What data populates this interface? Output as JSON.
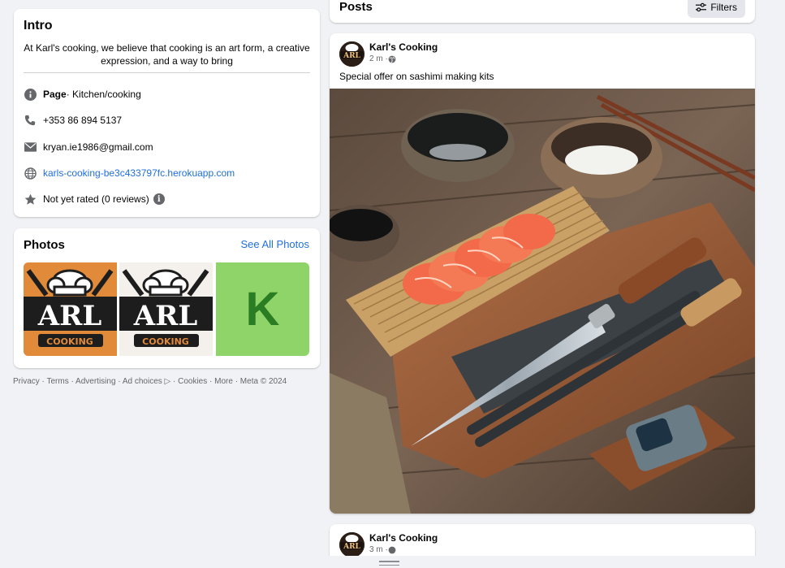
{
  "intro": {
    "title": "Intro",
    "bio": "At Karl's cooking, we believe that cooking is an art form, a creative expression, and a way to bring",
    "page_label": "Page",
    "category": " · Kitchen/cooking",
    "phone": "+353 86 894 5137",
    "email": "kryan.ie1986@gmail.com",
    "website": "karls-cooking-be3c433797fc.herokuapp.com",
    "rating": "Not yet rated (0 reviews)"
  },
  "photos": {
    "title": "Photos",
    "see_all": "See All Photos",
    "thumb_logo_top": "ARL",
    "thumb_logo_bottom": "COOKING",
    "thumb_letter": "K"
  },
  "footer": "Privacy · Terms · Advertising · Ad choices ▷ · Cookies · More · Meta © 2024",
  "posts": {
    "title": "Posts",
    "filters_label": "Filters",
    "items": [
      {
        "author": "Karl's Cooking",
        "time": "2 m · ",
        "text": "Special offer on sashimi making kits"
      },
      {
        "author": "Karl's Cooking",
        "time": "3 m · "
      }
    ]
  },
  "colors": {
    "link": "#216fdb",
    "background": "#f0f2f5",
    "card": "#ffffff",
    "secondary_text": "#65676b"
  }
}
